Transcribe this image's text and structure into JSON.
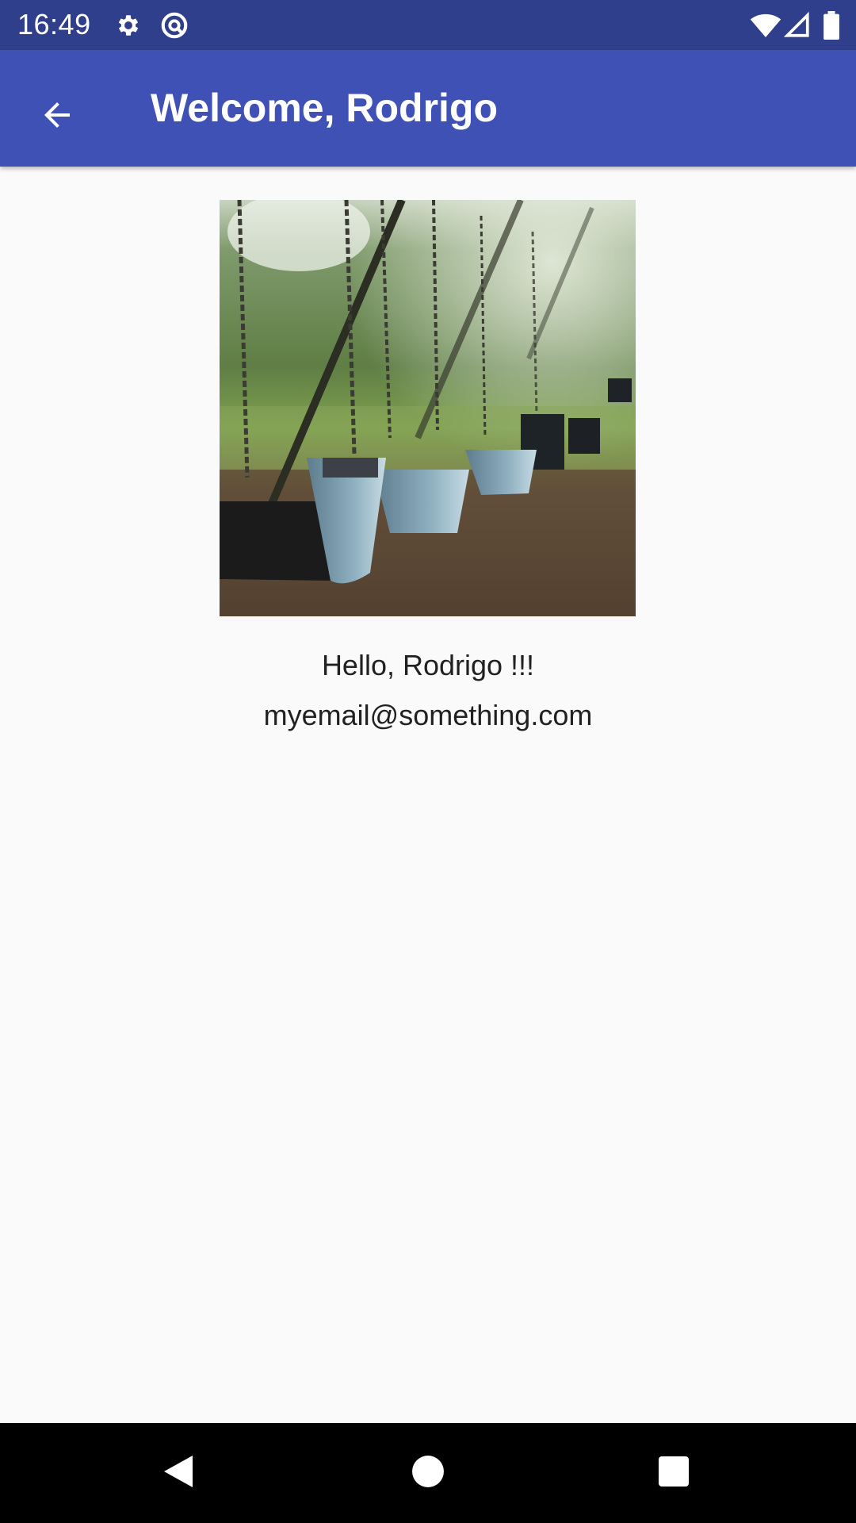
{
  "status_bar": {
    "time": "16:49",
    "left_icons": [
      "gear-icon",
      "data-saver-icon"
    ],
    "right_icons": [
      "wifi-icon",
      "cell-signal-icon",
      "battery-icon"
    ],
    "background": "#303f8c"
  },
  "app_bar": {
    "title": "Welcome, Rodrigo",
    "back_icon": "arrow-back-icon",
    "background": "#3f51b5"
  },
  "profile": {
    "image_subject": "playground swings",
    "greeting": "Hello, Rodrigo !!!",
    "email": "myemail@something.com"
  },
  "nav_bar": {
    "buttons": [
      "back-triangle-icon",
      "home-circle-icon",
      "recents-square-icon"
    ]
  }
}
